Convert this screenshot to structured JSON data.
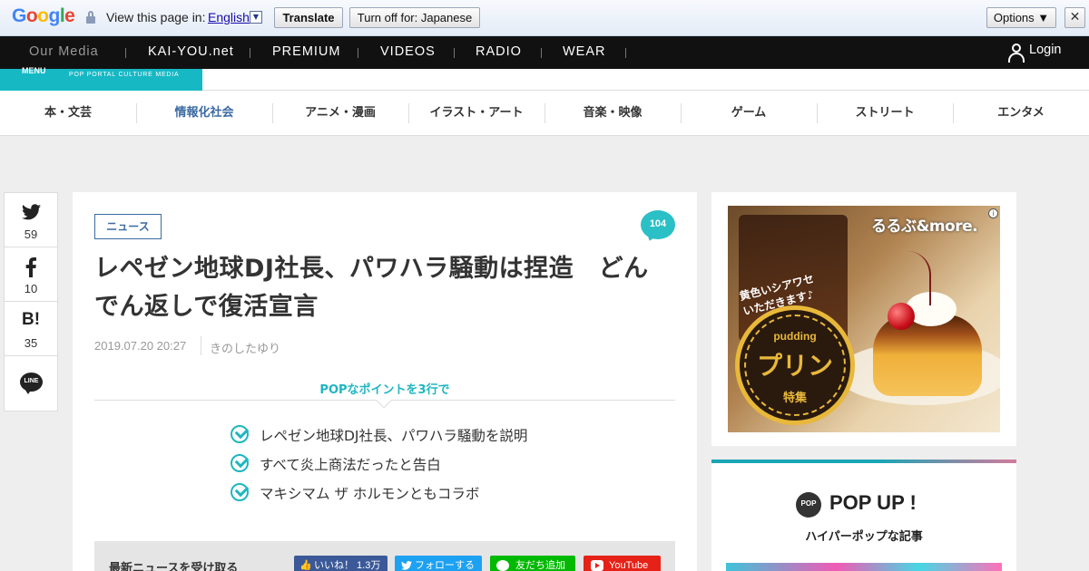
{
  "translate_bar": {
    "brand": "Google",
    "prompt": "View this page in:",
    "language": "English",
    "translate_label": "Translate",
    "turn_off_label": "Turn off for: Japanese",
    "options_label": "Options ▼",
    "close_label": "✕"
  },
  "top_nav": {
    "items": [
      "Our Media",
      "KAI-YOU.net",
      "PREMIUM",
      "VIDEOS",
      "RADIO",
      "WEAR"
    ],
    "login_label": "Login"
  },
  "logo": {
    "menu_label": "MENU",
    "tagline": "POP PORTAL CULTURE MEDIA"
  },
  "categories": [
    {
      "label": "本・文芸",
      "active": false
    },
    {
      "label": "情報化社会",
      "active": true
    },
    {
      "label": "アニメ・漫画",
      "active": false
    },
    {
      "label": "イラスト・アート",
      "active": false
    },
    {
      "label": "音楽・映像",
      "active": false
    },
    {
      "label": "ゲーム",
      "active": false
    },
    {
      "label": "ストリート",
      "active": false
    },
    {
      "label": "エンタメ",
      "active": false
    }
  ],
  "share": {
    "twitter_count": "59",
    "facebook_count": "10",
    "hatena_label": "B!",
    "hatena_count": "35",
    "line_label": "LINE"
  },
  "article": {
    "tag": "ニュース",
    "comment_count": "104",
    "title_line1": "レペゼン地球DJ社長、パワハラ騒動は捏造　どん",
    "title_line2": "でん返しで復活宣言",
    "date": "2019.07.20 20:27",
    "author": "きのしたゆり",
    "pop_heading": "POPなポイントを3行で",
    "points": [
      "レペゼン地球DJ社長、パワハラ騒動を説明",
      "すべて炎上商法だったと告白",
      "マキシマム ザ ホルモンともコラボ"
    ],
    "follow_label": "最新ニュースを受け取る",
    "follow_buttons": {
      "facebook": "いいね！ 1.3万",
      "twitter": "フォローする",
      "line": "友だち追加",
      "youtube": "YouTube"
    }
  },
  "sidebar": {
    "ad": {
      "brand": "るるぶ&more.",
      "slogan_line1": "黄色いシアワセ",
      "slogan_line2": "いただきます♪",
      "badge_top": "pudding",
      "badge_main": "プリン",
      "badge_bottom": "特集"
    },
    "popup": {
      "icon_label": "POP",
      "title": "POP UP !",
      "subtitle": "ハイパーポップな記事"
    }
  },
  "colors": {
    "accent_teal": "#16b8c4",
    "link_blue": "#3b6aa3",
    "nav_black": "#111111"
  }
}
